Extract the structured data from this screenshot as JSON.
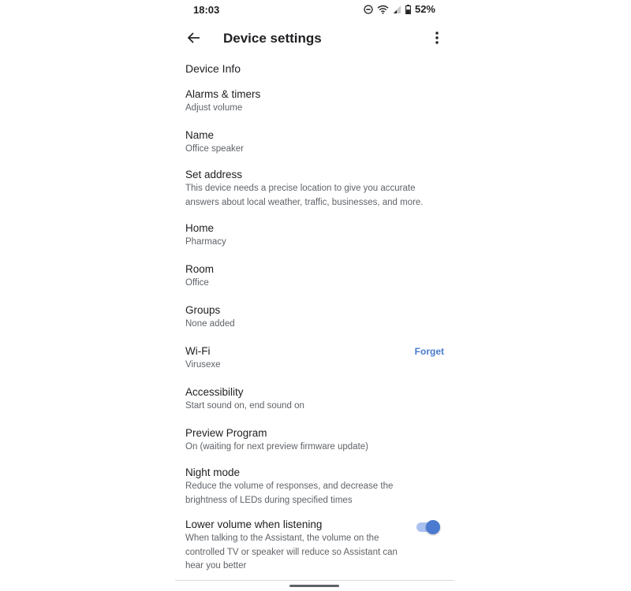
{
  "status_bar": {
    "time": "18:03",
    "battery": "52%",
    "icons": [
      "do-not-disturb-icon",
      "wifi-icon",
      "signal-icon",
      "battery-icon"
    ]
  },
  "app_bar": {
    "title": "Device settings",
    "back_icon": "back-arrow-icon",
    "more_icon": "more-vert-icon"
  },
  "section": {
    "header": "Device Info"
  },
  "settings": [
    {
      "title": "Alarms & timers",
      "desc": "Adjust volume"
    },
    {
      "title": "Name",
      "desc": "Office speaker"
    },
    {
      "title": "Set address",
      "desc": "This device needs a precise location to give you accurate answers about local weather, traffic, businesses, and more."
    },
    {
      "title": "Home",
      "desc": "Pharmacy"
    },
    {
      "title": "Room",
      "desc": "Office"
    },
    {
      "title": "Groups",
      "desc": "None added"
    },
    {
      "title": "Wi-Fi",
      "desc": "Virusexe",
      "action": "Forget"
    },
    {
      "title": "Accessibility",
      "desc": "Start sound on, end sound on"
    },
    {
      "title": "Preview Program",
      "desc": "On (waiting for next preview firmware update)"
    },
    {
      "title": "Night mode",
      "desc": "Reduce the volume of responses, and decrease the brightness of LEDs during specified times"
    },
    {
      "title": "Lower volume when listening",
      "desc": "When talking to the Assistant, the volume on the controlled TV or speaker will reduce so Assistant can hear you better",
      "toggle_on": true
    }
  ],
  "colors": {
    "accent": "#4a7bd0",
    "accent_light": "#a9c2f0",
    "text_primary": "#202124",
    "text_secondary": "#5f6368"
  }
}
